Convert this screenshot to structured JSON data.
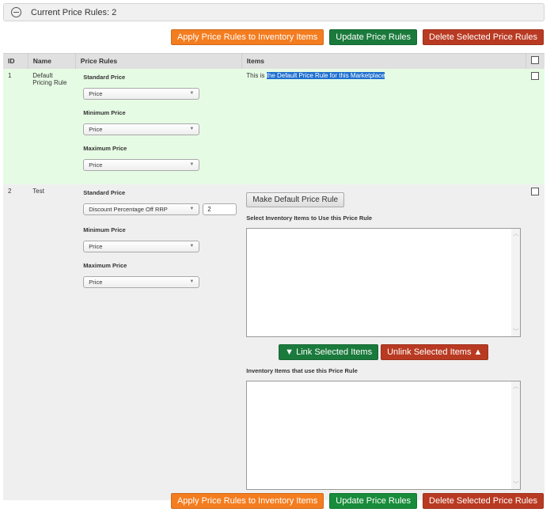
{
  "panel": {
    "title": "Current Price Rules: 2",
    "collapse_icon": "minus-circle-icon"
  },
  "actions": {
    "apply": "Apply Price Rules to Inventory Items",
    "update": "Update Price Rules",
    "delete": "Delete Selected Price Rules"
  },
  "table": {
    "headers": {
      "id": "ID",
      "name": "Name",
      "price_rules": "Price Rules",
      "items": "Items"
    },
    "rows": [
      {
        "id": "1",
        "name": "Default Pricing Rule",
        "standard_label": "Standard Price",
        "standard_value": "Price",
        "minimum_label": "Minimum Price",
        "minimum_value": "Price",
        "maximum_label": "Maximum Price",
        "maximum_value": "Price",
        "items_prefix": "This is ",
        "items_highlight": "the Default Price Rule for this Marketplace"
      },
      {
        "id": "2",
        "name": "Test",
        "standard_label": "Standard Price",
        "standard_value": "Discount Percentage Off RRP",
        "standard_amount": "2",
        "minimum_label": "Minimum Price",
        "minimum_value": "Price",
        "maximum_label": "Maximum Price",
        "maximum_value": "Price",
        "make_default": "Make Default Price Rule",
        "select_label": "Select Inventory Items to Use this Price Rule",
        "link": "▼ Link Selected Items",
        "unlink": "Unlink Selected Items ▲",
        "linked_label": "Inventory Items that use this Price Rule"
      }
    ]
  }
}
